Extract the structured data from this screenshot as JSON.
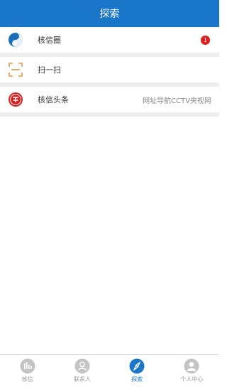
{
  "header": {
    "title": "探索"
  },
  "menu": [
    {
      "label": "核信圈",
      "badge": "1",
      "icon": "moments-circle-icon"
    },
    {
      "label": "扫一扫",
      "icon": "scan-icon"
    },
    {
      "label": "核信头条",
      "right_text": "网址导航CCTV央视网",
      "icon": "headline-coin-icon"
    }
  ],
  "tabbar": {
    "items": [
      {
        "label": "核信",
        "icon": "chat-icon",
        "active": false
      },
      {
        "label": "联系人",
        "icon": "contacts-icon",
        "active": false
      },
      {
        "label": "探索",
        "icon": "compass-icon",
        "active": true
      },
      {
        "label": "个人中心",
        "icon": "user-icon",
        "active": false
      }
    ]
  },
  "colors": {
    "accent": "#1976c8",
    "badge": "#e21b1b",
    "scan_icon": "#e29a4a",
    "headline_icon": "#d42020"
  }
}
